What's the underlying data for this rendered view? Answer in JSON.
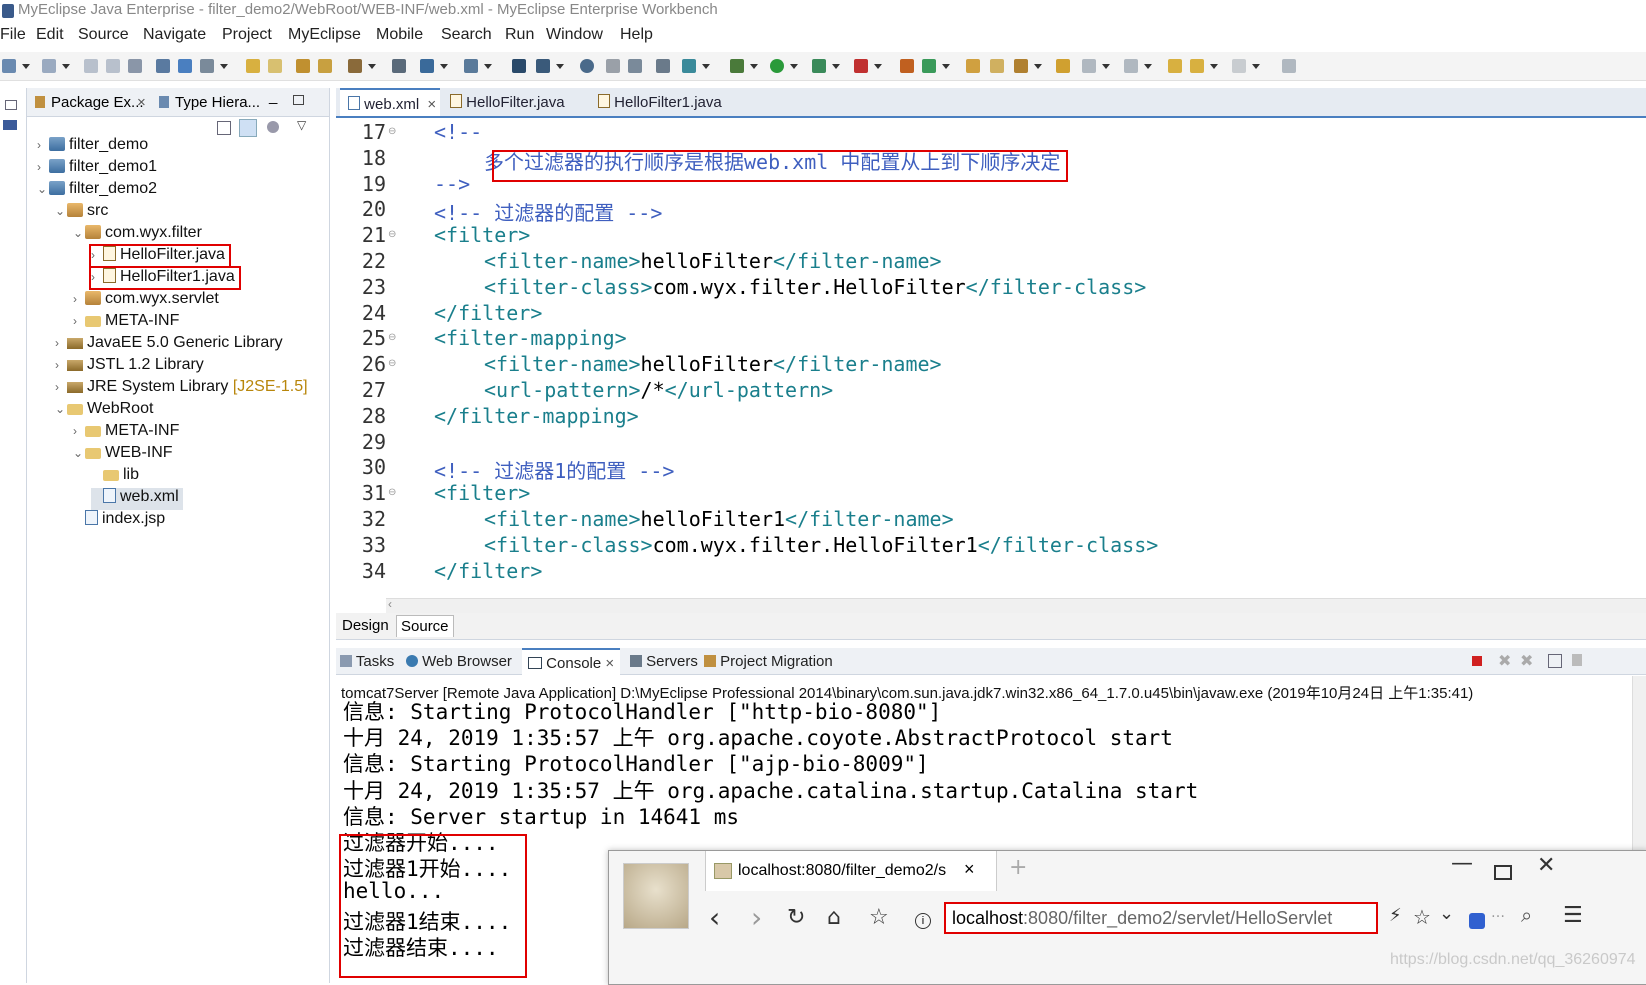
{
  "window": {
    "title": "MyEclipse Java Enterprise - filter_demo2/WebRoot/WEB-INF/web.xml - MyEclipse Enterprise Workbench"
  },
  "menu": [
    "File",
    "Edit",
    "Source",
    "Navigate",
    "Project",
    "MyEclipse",
    "Mobile",
    "Search",
    "Run",
    "Window",
    "Help"
  ],
  "package_explorer": {
    "tabs": [
      "Package Ex...",
      "Type Hiera..."
    ],
    "tree": [
      {
        "label": "filter_demo"
      },
      {
        "label": "filter_demo1"
      },
      {
        "label": "filter_demo2"
      },
      {
        "label": "src"
      },
      {
        "label": "com.wyx.filter"
      },
      {
        "label": "HelloFilter.java"
      },
      {
        "label": "HelloFilter1.java"
      },
      {
        "label": "com.wyx.servlet"
      },
      {
        "label": "META-INF"
      },
      {
        "label": "JavaEE 5.0 Generic Library"
      },
      {
        "label": "JSTL 1.2 Library"
      },
      {
        "label": "JRE System Library",
        "suffix": "[J2SE-1.5]"
      },
      {
        "label": "WebRoot"
      },
      {
        "label": "META-INF"
      },
      {
        "label": "WEB-INF"
      },
      {
        "label": "lib"
      },
      {
        "label": "web.xml"
      },
      {
        "label": "index.jsp"
      }
    ]
  },
  "editor": {
    "tabs": [
      "web.xml",
      "HelloFilter.java",
      "HelloFilter1.java"
    ],
    "lines": [
      {
        "n": "17",
        "parts": [
          {
            "t": "<!--",
            "c": "cm"
          }
        ]
      },
      {
        "n": "18",
        "parts": [
          {
            "t": "多个过滤器的执行顺序是根据web.xml 中配置从上到下顺序决定",
            "c": "cm"
          }
        ]
      },
      {
        "n": "19",
        "parts": [
          {
            "t": "-->",
            "c": "cm"
          }
        ]
      },
      {
        "n": "20",
        "parts": [
          {
            "t": "<!-- 过滤器的配置 -->",
            "c": "cm"
          }
        ]
      },
      {
        "n": "21",
        "parts": [
          {
            "t": "<filter>",
            "c": "tag"
          }
        ]
      },
      {
        "n": "22",
        "parts": [
          {
            "t": "<filter-name>",
            "c": "tag"
          },
          {
            "t": "helloFilter",
            "c": "txt"
          },
          {
            "t": "</filter-name>",
            "c": "tag"
          }
        ]
      },
      {
        "n": "23",
        "parts": [
          {
            "t": "<filter-class>",
            "c": "tag"
          },
          {
            "t": "com.wyx.filter.HelloFilter",
            "c": "txt"
          },
          {
            "t": "</filter-class>",
            "c": "tag"
          }
        ]
      },
      {
        "n": "24",
        "parts": [
          {
            "t": "</filter>",
            "c": "tag"
          }
        ]
      },
      {
        "n": "25",
        "parts": [
          {
            "t": "<filter-mapping>",
            "c": "tag"
          }
        ]
      },
      {
        "n": "26",
        "parts": [
          {
            "t": "<filter-name>",
            "c": "tag"
          },
          {
            "t": "helloFilter",
            "c": "txt"
          },
          {
            "t": "</filter-name>",
            "c": "tag"
          }
        ]
      },
      {
        "n": "27",
        "parts": [
          {
            "t": "<url-pattern>",
            "c": "tag"
          },
          {
            "t": "/*",
            "c": "txt"
          },
          {
            "t": "</url-pattern>",
            "c": "tag"
          }
        ]
      },
      {
        "n": "28",
        "parts": [
          {
            "t": "</filter-mapping>",
            "c": "tag"
          }
        ]
      },
      {
        "n": "29",
        "parts": []
      },
      {
        "n": "30",
        "parts": [
          {
            "t": "<!-- 过滤器1的配置 -->",
            "c": "cm"
          }
        ]
      },
      {
        "n": "31",
        "parts": [
          {
            "t": "<filter>",
            "c": "tag"
          }
        ]
      },
      {
        "n": "32",
        "parts": [
          {
            "t": "<filter-name>",
            "c": "tag"
          },
          {
            "t": "helloFilter1",
            "c": "txt"
          },
          {
            "t": "</filter-name>",
            "c": "tag"
          }
        ]
      },
      {
        "n": "33",
        "parts": [
          {
            "t": "<filter-class>",
            "c": "tag"
          },
          {
            "t": "com.wyx.filter.HelloFilter1",
            "c": "txt"
          },
          {
            "t": "</filter-class>",
            "c": "tag"
          }
        ]
      },
      {
        "n": "34",
        "parts": [
          {
            "t": "</filter>",
            "c": "tag"
          }
        ]
      }
    ],
    "bottom_tabs": [
      "Design",
      "Source"
    ]
  },
  "console": {
    "tabs": [
      "Tasks",
      "Web Browser",
      "Console",
      "Servers",
      "Project Migration"
    ],
    "header": "tomcat7Server [Remote Java Application] D:\\MyEclipse Professional 2014\\binary\\com.sun.java.jdk7.win32.x86_64_1.7.0.u45\\bin\\javaw.exe (2019年10月24日 上午1:35:41)",
    "lines": [
      "信息: Starting ProtocolHandler [\"http-bio-8080\"]",
      "十月 24, 2019 1:35:57 上午 org.apache.coyote.AbstractProtocol start",
      "信息: Starting ProtocolHandler [\"ajp-bio-8009\"]",
      "十月 24, 2019 1:35:57 上午 org.apache.catalina.startup.Catalina start",
      "信息: Server startup in 14641 ms",
      "过滤器开始....",
      "过滤器1开始....",
      "hello...",
      "过滤器1结束....",
      "过滤器结束...."
    ]
  },
  "browser": {
    "tab_title": "localhost:8080/filter_demo2/s",
    "url_host": "localhost",
    "url_rest": ":8080/filter_demo2/servlet/HelloServlet"
  },
  "watermark": "https://blog.csdn.net/qq_36260974"
}
